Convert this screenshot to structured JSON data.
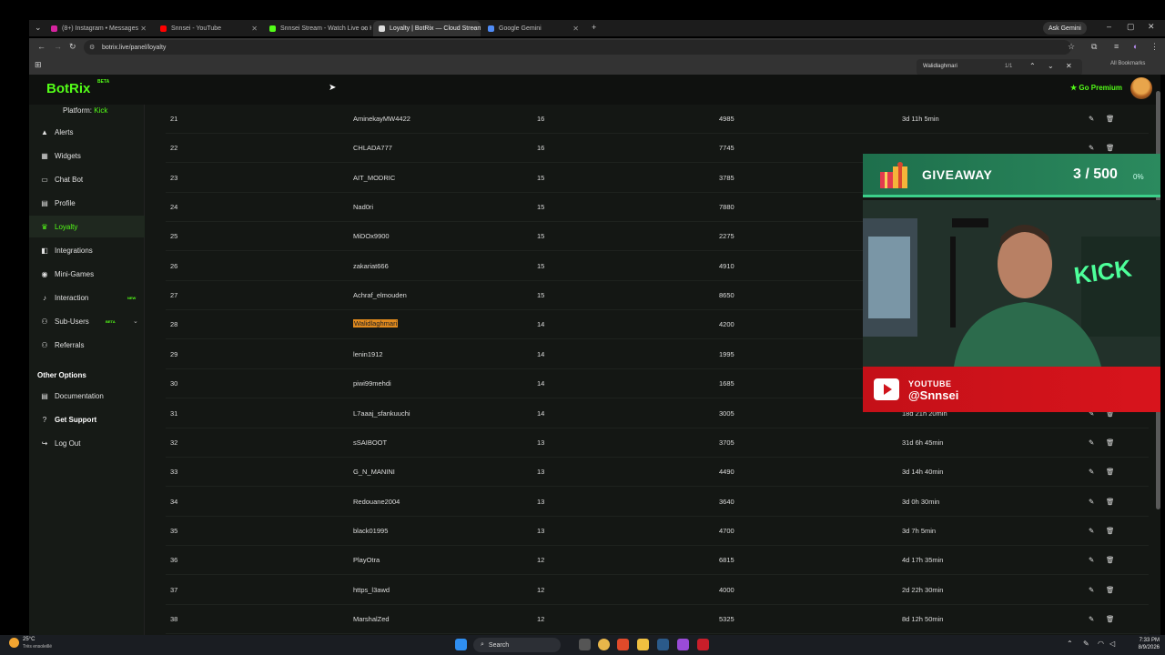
{
  "browser": {
    "tabs": [
      {
        "label": "(8+) Instagram • Messages",
        "color": "#d6249f"
      },
      {
        "label": "Snnsei - YouTube",
        "color": "#ff0000"
      },
      {
        "label": "Snnsei Stream - Watch Live on K",
        "color": "#53fc18"
      },
      {
        "label": "Loyalty | BotRix — Cloud Streami",
        "color": "#dddddd"
      },
      {
        "label": "Google Gemini",
        "color": "#4f8bf5"
      }
    ],
    "ask_gemini": "Ask Gemini",
    "url": "botrix.live/panel/loyalty",
    "all_bookmarks": "All Bookmarks",
    "find": {
      "query": "Walidlaghmari",
      "count": "1/1"
    }
  },
  "header": {
    "logo": "BotRix",
    "logo_badge": "BETA",
    "premium": "Go Premium"
  },
  "sidebar": {
    "platform_label": "Platform:",
    "platform_value": "Kick",
    "items": [
      {
        "label": "Alerts",
        "icon": "▲"
      },
      {
        "label": "Widgets",
        "icon": "▦"
      },
      {
        "label": "Chat Bot",
        "icon": "▭"
      },
      {
        "label": "Profile",
        "icon": "▤"
      },
      {
        "label": "Loyalty",
        "icon": "♛"
      },
      {
        "label": "Integrations",
        "icon": "◧"
      },
      {
        "label": "Mini-Games",
        "icon": "◉"
      },
      {
        "label": "Interaction",
        "icon": "♪",
        "badge": "NEW"
      },
      {
        "label": "Sub-Users",
        "icon": "⚇",
        "badge": "BETA"
      },
      {
        "label": "Referrals",
        "icon": "⚇"
      }
    ],
    "other_options": "Other Options",
    "other_items": [
      {
        "label": "Documentation",
        "icon": "▤"
      },
      {
        "label": "Get Support",
        "icon": "?"
      },
      {
        "label": "Log Out",
        "icon": "↪"
      }
    ]
  },
  "table": {
    "rows": [
      {
        "rank": "21",
        "user": "AminekayMW4422",
        "level": "16",
        "points": "4985",
        "watch": "3d 11h 5min"
      },
      {
        "rank": "22",
        "user": "CHLADA777",
        "level": "16",
        "points": "7745",
        "watch": ""
      },
      {
        "rank": "23",
        "user": "AIT_MODRIC",
        "level": "15",
        "points": "3785",
        "watch": ""
      },
      {
        "rank": "24",
        "user": "Nad0ri",
        "level": "15",
        "points": "7880",
        "watch": ""
      },
      {
        "rank": "25",
        "user": "MiDOx9900",
        "level": "15",
        "points": "2275",
        "watch": ""
      },
      {
        "rank": "26",
        "user": "zakariat666",
        "level": "15",
        "points": "4910",
        "watch": ""
      },
      {
        "rank": "27",
        "user": "Achraf_elmouden",
        "level": "15",
        "points": "8650",
        "watch": ""
      },
      {
        "rank": "28",
        "user": "Walidlaghmari",
        "level": "14",
        "points": "4200",
        "watch": ""
      },
      {
        "rank": "29",
        "user": "lenin1912",
        "level": "14",
        "points": "1995",
        "watch": ""
      },
      {
        "rank": "30",
        "user": "piwi99mehdi",
        "level": "14",
        "points": "1685",
        "watch": ""
      },
      {
        "rank": "31",
        "user": "L7aaaj_sfankuuchi",
        "level": "14",
        "points": "3005",
        "watch": "18d 21h 20min"
      },
      {
        "rank": "32",
        "user": "sSAIBOOT",
        "level": "13",
        "points": "3705",
        "watch": "31d 6h 45min"
      },
      {
        "rank": "33",
        "user": "G_N_MANINI",
        "level": "13",
        "points": "4490",
        "watch": "3d 14h 40min"
      },
      {
        "rank": "34",
        "user": "Redouane2004",
        "level": "13",
        "points": "3640",
        "watch": "3d 0h 30min"
      },
      {
        "rank": "35",
        "user": "black01995",
        "level": "13",
        "points": "4700",
        "watch": "3d 7h 5min"
      },
      {
        "rank": "36",
        "user": "PlayOtra",
        "level": "12",
        "points": "6815",
        "watch": "4d 17h 35min"
      },
      {
        "rank": "37",
        "user": "https_l3awd",
        "level": "12",
        "points": "4000",
        "watch": "2d 22h 30min"
      },
      {
        "rank": "38",
        "user": "MarshalZed",
        "level": "12",
        "points": "5325",
        "watch": "8d 12h 50min"
      }
    ]
  },
  "overlay": {
    "giveaway_title": "GIVEAWAY",
    "giveaway_count": "3 / 500",
    "giveaway_pct": "0%",
    "progress": 0.006,
    "yt_label": "YOUTUBE",
    "yt_handle": "@Snnsei"
  },
  "taskbar": {
    "temp": "25°C",
    "weather": "Très ensoleillé",
    "search": "Search",
    "time": "7:33 PM",
    "date": "8/9/2026"
  }
}
